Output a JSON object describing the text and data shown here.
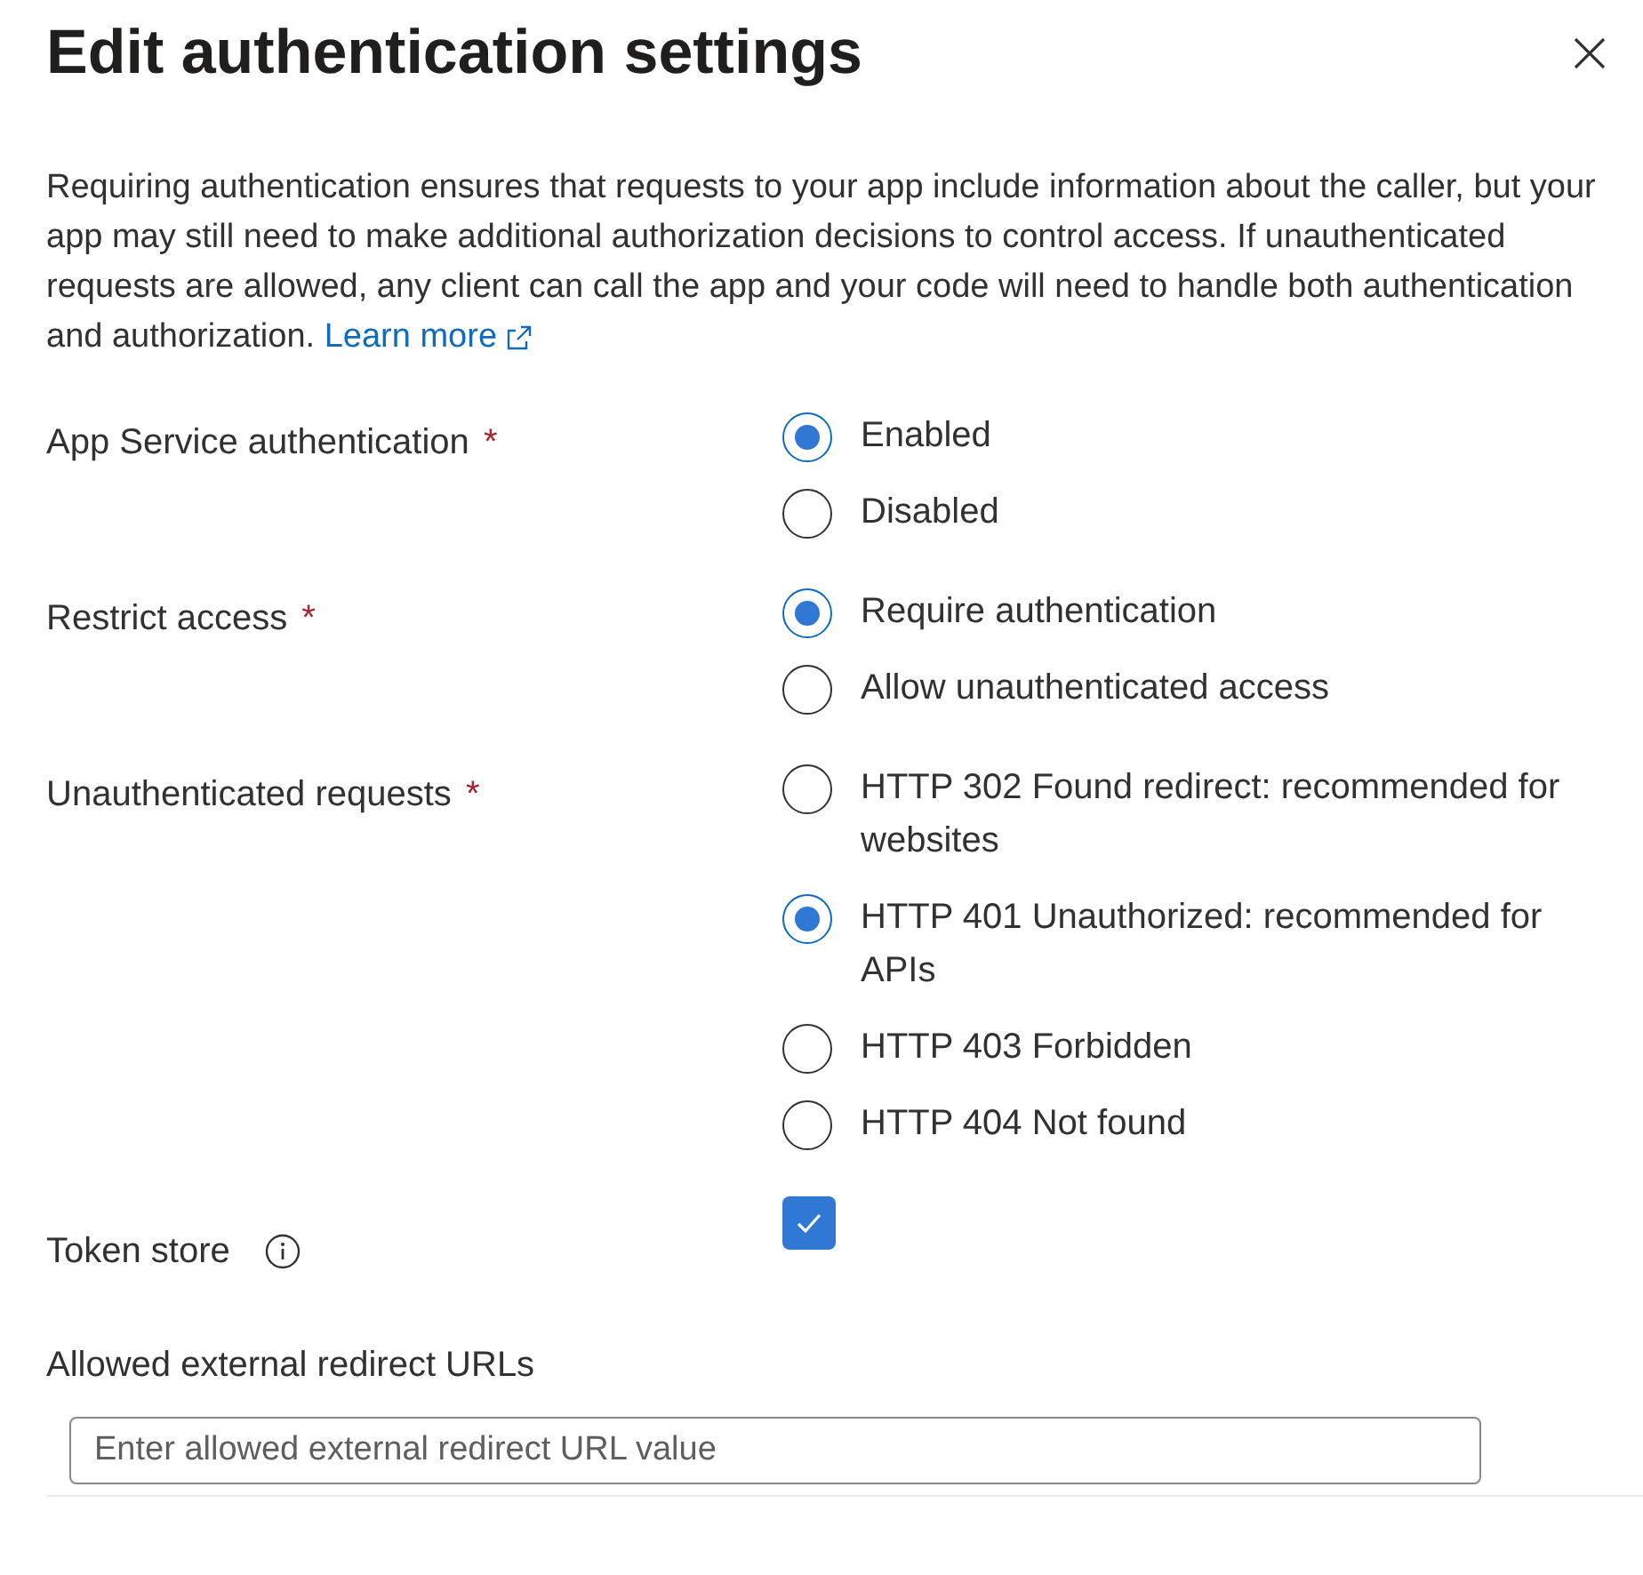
{
  "panel": {
    "title": "Edit authentication settings"
  },
  "description": {
    "text": "Requiring authentication ensures that requests to your app include information about the caller, but your app may still need to make additional authorization decisions to control access. If unauthenticated requests are allowed, any client can call the app and your code will need to handle both authentication and authorization.",
    "link": "Learn more"
  },
  "fields": [
    {
      "kind": "radio",
      "label": "App Service authentication",
      "required_mark": "*",
      "options": [
        {
          "label": "Enabled",
          "selected": true
        },
        {
          "label": "Disabled",
          "selected": false
        }
      ]
    },
    {
      "kind": "radio",
      "label": "Restrict access",
      "required_mark": "*",
      "options": [
        {
          "label": "Require authentication",
          "selected": true
        },
        {
          "label": "Allow unauthenticated access",
          "selected": false
        }
      ]
    },
    {
      "kind": "radio",
      "label": "Unauthenticated requests",
      "required_mark": "*",
      "options": [
        {
          "label": "HTTP 302 Found redirect: recommended for websites",
          "selected": false
        },
        {
          "label": "HTTP 401 Unauthorized: recommended for APIs",
          "selected": true
        },
        {
          "label": "HTTP 403 Forbidden",
          "selected": false
        },
        {
          "label": "HTTP 404 Not found",
          "selected": false
        }
      ]
    },
    {
      "kind": "checkbox",
      "label": "Token store",
      "info": true,
      "checked": true
    },
    {
      "kind": "text",
      "label": "Allowed external redirect URLs",
      "placeholder": "Enter allowed external redirect URL value"
    }
  ]
}
